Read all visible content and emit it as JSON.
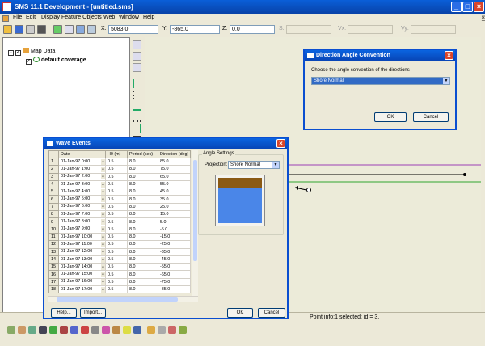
{
  "app": {
    "title": "SMS 11.1 Development - [untitled.sms]"
  },
  "menu": [
    "File",
    "Edit",
    "Display",
    "Feature Objects",
    "Web",
    "Window",
    "Help"
  ],
  "mdi_controls": {
    "minimize": "_",
    "restore": "□",
    "close": "×"
  },
  "toolbar": {
    "x_label": "X:",
    "x_value": "5083.0",
    "y_label": "Y:",
    "y_value": "-865.0",
    "z_label": "Z:",
    "z_value": "0.0",
    "s_label": "S:",
    "vx_label": "Vx:",
    "vy_label": "Vy:"
  },
  "tree": {
    "root_label": "Map Data",
    "child_label": "default coverage"
  },
  "status": {
    "text": "Point info:1 selected; id = 3."
  },
  "direction_dialog": {
    "title": "Direction Angle Convention",
    "prompt": "Choose the angle convention of the directions",
    "selected": "Shore Normal",
    "ok": "OK",
    "cancel": "Cancel"
  },
  "wave_dialog": {
    "title": "Wave Events",
    "columns": [
      "Date",
      "H0 (m)",
      "Period (sec)",
      "Direction (deg)"
    ],
    "rows": [
      [
        "1",
        "01-Jan-97 0:00",
        "0.5",
        "8.0",
        "85.0"
      ],
      [
        "2",
        "01-Jan-97 1:00",
        "0.5",
        "8.0",
        "75.0"
      ],
      [
        "3",
        "01-Jan-97 2:00",
        "0.5",
        "8.0",
        "65.0"
      ],
      [
        "4",
        "01-Jan-97 3:00",
        "0.5",
        "8.0",
        "55.0"
      ],
      [
        "5",
        "01-Jan-97 4:00",
        "0.5",
        "8.0",
        "45.0"
      ],
      [
        "6",
        "01-Jan-97 5:00",
        "0.5",
        "8.0",
        "35.0"
      ],
      [
        "7",
        "01-Jan-97 6:00",
        "0.5",
        "8.0",
        "25.0"
      ],
      [
        "8",
        "01-Jan-97 7:00",
        "0.5",
        "8.0",
        "15.0"
      ],
      [
        "9",
        "01-Jan-97 8:00",
        "0.5",
        "8.0",
        "5.0"
      ],
      [
        "10",
        "01-Jan-97 9:00",
        "0.5",
        "8.0",
        "-5.0"
      ],
      [
        "11",
        "01-Jan-97 10:00",
        "0.5",
        "8.0",
        "-15.0"
      ],
      [
        "12",
        "01-Jan-97 11:00",
        "0.5",
        "8.0",
        "-25.0"
      ],
      [
        "13",
        "01-Jan-97 12:00",
        "0.5",
        "8.0",
        "-35.0"
      ],
      [
        "14",
        "01-Jan-97 13:00",
        "0.5",
        "8.0",
        "-45.0"
      ],
      [
        "15",
        "01-Jan-97 14:00",
        "0.5",
        "8.0",
        "-55.0"
      ],
      [
        "16",
        "01-Jan-97 15:00",
        "0.5",
        "8.0",
        "-65.0"
      ],
      [
        "17",
        "01-Jan-97 16:00",
        "0.5",
        "8.0",
        "-75.0"
      ],
      [
        "18",
        "01-Jan-97 17:00",
        "0.5",
        "8.0",
        "-85.0"
      ]
    ],
    "angle_settings_label": "Angle Settings",
    "projection_label": "Projection:",
    "projection_value": "Shore Normal",
    "help": "Help...",
    "import": "Import...",
    "ok": "OK",
    "cancel": "Cancel"
  },
  "colors": {
    "titlebar": "#0a5fd8",
    "land": "#8b5a14",
    "water": "#4a86e8",
    "purple_line": "#9b3fb5",
    "green_line": "#2fa52f"
  }
}
